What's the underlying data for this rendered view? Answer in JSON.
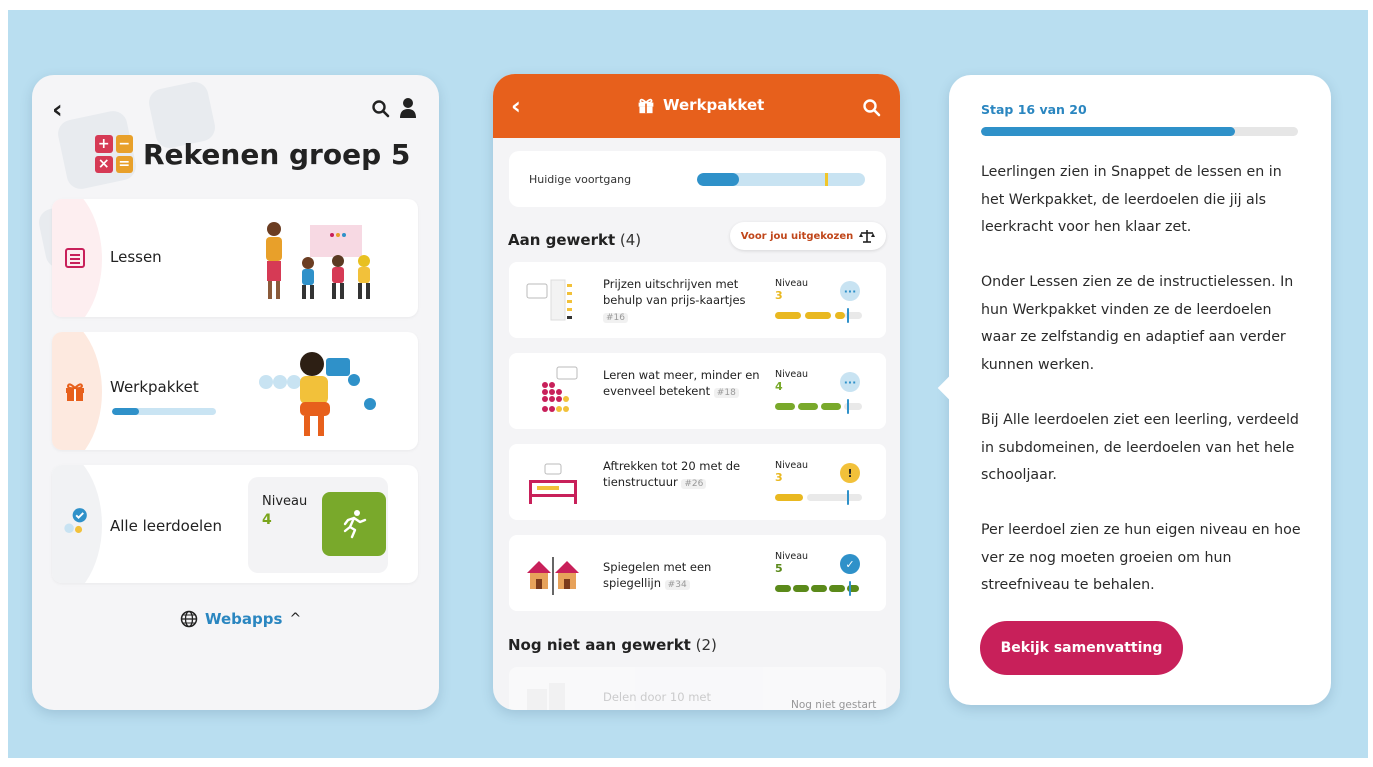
{
  "left_panel": {
    "title": "Rekenen groep 5",
    "logo_symbols": [
      "+",
      "−",
      "×",
      "="
    ],
    "cards": [
      {
        "label": "Lessen",
        "icon": "list-icon"
      },
      {
        "label": "Werkpakket",
        "icon": "gift-icon",
        "progress": 0.26
      },
      {
        "label": "Alle leerdoelen",
        "icon": "goals-icon",
        "niveau_label": "Niveau",
        "niveau_value": "4"
      }
    ],
    "webapps_label": "Webapps"
  },
  "middle_panel": {
    "header_title": "Werkpakket",
    "progress_label": "Huidige voortgang",
    "progress_fill": 0.25,
    "progress_marker": 0.76,
    "section_done_label": "Aan gewerkt",
    "section_done_count": "(4)",
    "filter_button": "Voor jou uitgekozen",
    "items": [
      {
        "title": "Prijzen uitschrijven met behulp van prijs-kaartjes",
        "num": "#16",
        "niveau_label": "Niveau",
        "niveau": "3",
        "status": "dots"
      },
      {
        "title": "Leren wat meer, minder en evenveel betekent",
        "num": "#18",
        "niveau_label": "Niveau",
        "niveau": "4",
        "status": "dots"
      },
      {
        "title": "Aftrekken tot 20 met de tienstructuur",
        "num": "#26",
        "niveau_label": "Niveau",
        "niveau": "3",
        "status": "warning"
      },
      {
        "title": "Spiegelen met een spiegellijn",
        "num": "#34",
        "niveau_label": "Niveau",
        "niveau": "5",
        "status": "check"
      }
    ],
    "section_todo_label": "Nog niet aan gewerkt",
    "section_todo_count": "(2)",
    "todo_items": [
      {
        "title": "Delen door 10 met",
        "status_text": "Nog niet gestart"
      }
    ]
  },
  "right_panel": {
    "step_text": "Stap 16 van 20",
    "step_progress": 0.8,
    "paragraphs": [
      "Leerlingen zien in Snappet de lessen en in het Werkpakket, de leerdoelen die jij als leerkracht voor hen klaar zet.",
      "Onder Lessen zien ze de instructielessen. In hun Werkpakket vinden ze de leerdoelen waar ze zelfstandig en adaptief aan verder kunnen werken.",
      "Bij Alle leerdoelen ziet een leerling, verdeeld in subdomeinen, de leerdoelen van het hele schooljaar.",
      "Per leerdoel zien ze hun eigen niveau en hoe ver ze nog moeten groeien om hun streefniveau te behalen."
    ],
    "button_label": "Bekijk samenvatting"
  },
  "colors": {
    "background": "#b9def0",
    "header_orange": "#e7601c",
    "accent_blue": "#2f91c9",
    "button_pink": "#c8205a",
    "level_yellow": "#e9b820",
    "level_green": "#79a92b"
  }
}
